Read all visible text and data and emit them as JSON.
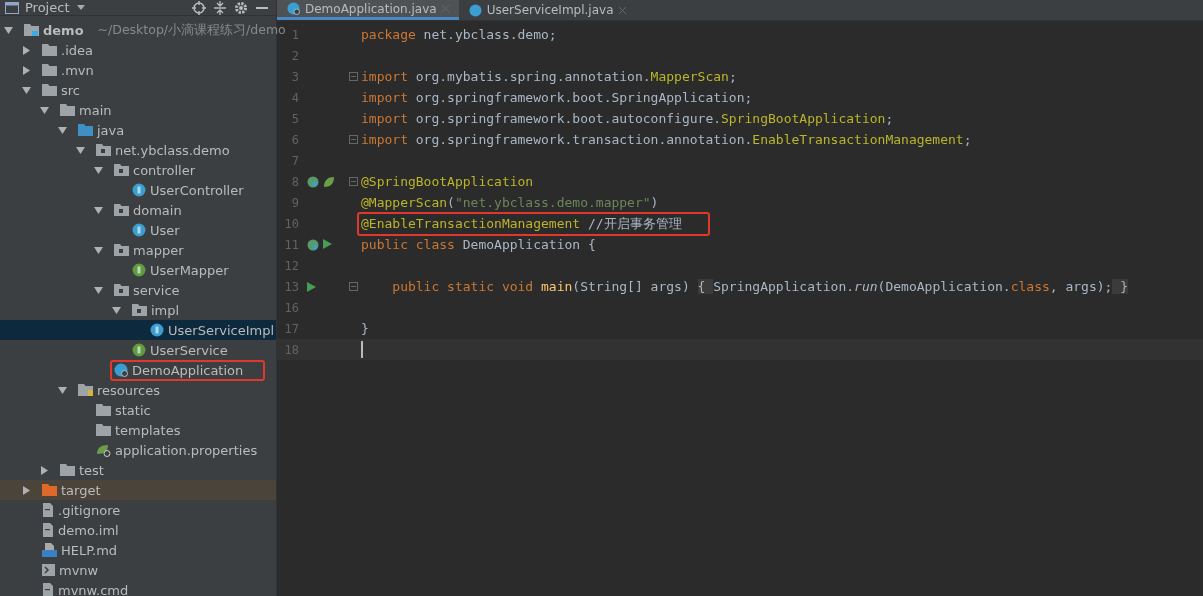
{
  "project_panel": {
    "title": "Project"
  },
  "tree": [
    {
      "label": "demo",
      "path": "~/Desktop/小滴课程练习/demo",
      "kind": "module",
      "expanded": true,
      "selected": false,
      "children": [
        {
          "label": ".idea",
          "kind": "folder",
          "expanded": false,
          "selected": false
        },
        {
          "label": ".mvn",
          "kind": "folder",
          "expanded": false,
          "selected": false
        },
        {
          "label": "src",
          "kind": "folder",
          "expanded": true,
          "selected": false,
          "children": [
            {
              "label": "main",
              "kind": "folder",
              "expanded": true,
              "selected": false,
              "children": [
                {
                  "label": "java",
                  "kind": "source-folder",
                  "expanded": true,
                  "selected": false,
                  "children": [
                    {
                      "label": "net.ybclass.demo",
                      "kind": "package",
                      "expanded": true,
                      "selected": false,
                      "children": [
                        {
                          "label": "controller",
                          "kind": "package",
                          "expanded": true,
                          "selected": false,
                          "children": [
                            {
                              "label": "UserController",
                              "kind": "class",
                              "selected": false
                            }
                          ]
                        },
                        {
                          "label": "domain",
                          "kind": "package",
                          "expanded": true,
                          "selected": false,
                          "children": [
                            {
                              "label": "User",
                              "kind": "class",
                              "selected": false
                            }
                          ]
                        },
                        {
                          "label": "mapper",
                          "kind": "package",
                          "expanded": true,
                          "selected": false,
                          "children": [
                            {
                              "label": "UserMapper",
                              "kind": "interface",
                              "selected": false
                            }
                          ]
                        },
                        {
                          "label": "service",
                          "kind": "package",
                          "expanded": true,
                          "selected": false,
                          "children": [
                            {
                              "label": "impl",
                              "kind": "package",
                              "expanded": true,
                              "selected": false,
                              "children": [
                                {
                                  "label": "UserServiceImpl",
                                  "kind": "class",
                                  "selected": true
                                }
                              ]
                            },
                            {
                              "label": "UserService",
                              "kind": "interface",
                              "selected": false
                            }
                          ]
                        },
                        {
                          "label": "DemoApplication",
                          "kind": "spring-class",
                          "selected": false,
                          "highlighted": true
                        }
                      ]
                    }
                  ]
                },
                {
                  "label": "resources",
                  "kind": "resource-folder",
                  "expanded": true,
                  "selected": false,
                  "children": [
                    {
                      "label": "static",
                      "kind": "folder",
                      "selected": false
                    },
                    {
                      "label": "templates",
                      "kind": "folder",
                      "selected": false
                    },
                    {
                      "label": "application.properties",
                      "kind": "spring-file",
                      "selected": false
                    }
                  ]
                }
              ]
            },
            {
              "label": "test",
              "kind": "folder",
              "expanded": false,
              "selected": false
            }
          ]
        },
        {
          "label": "target",
          "kind": "excluded-folder",
          "expanded": false,
          "selected": false
        },
        {
          "label": ".gitignore",
          "kind": "file",
          "selected": false
        },
        {
          "label": "demo.iml",
          "kind": "file",
          "selected": false
        },
        {
          "label": "HELP.md",
          "kind": "markdown",
          "selected": false
        },
        {
          "label": "mvnw",
          "kind": "script",
          "selected": false
        },
        {
          "label": "mvnw.cmd",
          "kind": "file",
          "selected": false
        }
      ]
    }
  ],
  "tabs": [
    {
      "label": "DemoApplication.java",
      "kind": "spring-class",
      "selected": true
    },
    {
      "label": "UserServiceImpl.java",
      "kind": "class",
      "selected": false
    }
  ],
  "lines": [
    {
      "number": "1",
      "tokens": [
        {
          "kind": "keyword",
          "text": "package"
        },
        {
          "kind": "plain",
          "text": " net.ybclass.demo;"
        }
      ]
    },
    {
      "number": "2"
    },
    {
      "number": "3",
      "fold": true,
      "tokens": [
        {
          "kind": "keyword",
          "text": "import"
        },
        {
          "kind": "plain",
          "text": " org.mybatis.spring.annotation."
        },
        {
          "kind": "annotation",
          "text": "MapperScan"
        },
        {
          "kind": "plain",
          "text": ";"
        }
      ]
    },
    {
      "number": "4",
      "tokens": [
        {
          "kind": "keyword",
          "text": "import"
        },
        {
          "kind": "plain",
          "text": " org.springframework.boot.SpringApplication;"
        }
      ]
    },
    {
      "number": "5",
      "tokens": [
        {
          "kind": "keyword",
          "text": "import"
        },
        {
          "kind": "plain",
          "text": " org.springframework.boot.autoconfigure."
        },
        {
          "kind": "annotation",
          "text": "SpringBootApplication"
        },
        {
          "kind": "plain",
          "text": ";"
        }
      ]
    },
    {
      "number": "6",
      "fold": true,
      "tokens": [
        {
          "kind": "keyword",
          "text": "import"
        },
        {
          "kind": "plain",
          "text": " org.springframework.transaction.annotation."
        },
        {
          "kind": "annotation",
          "text": "EnableTransactionManagement"
        },
        {
          "kind": "plain",
          "text": ";"
        }
      ]
    },
    {
      "number": "7"
    },
    {
      "number": "8",
      "fold": true,
      "gutter": [
        {
          "kind": "bean"
        },
        {
          "kind": "spring"
        }
      ],
      "tokens": [
        {
          "kind": "annotation",
          "text": "@SpringBootApplication"
        }
      ]
    },
    {
      "number": "9",
      "tokens": [
        {
          "kind": "annotation",
          "text": "@MapperScan"
        },
        {
          "kind": "plain",
          "text": "("
        },
        {
          "kind": "string",
          "text": "\"net.ybclass.demo.mapper\""
        },
        {
          "kind": "plain",
          "text": ")"
        }
      ]
    },
    {
      "number": "10",
      "highlighted": true,
      "tokens": [
        {
          "kind": "annotation",
          "text": "@EnableTransactionManagement"
        },
        {
          "kind": "comment",
          "text": " //开启事务管理"
        }
      ]
    },
    {
      "number": "11",
      "gutter": [
        {
          "kind": "bean"
        },
        {
          "kind": "run"
        }
      ],
      "tokens": [
        {
          "kind": "keyword",
          "text": "public class"
        },
        {
          "kind": "plain",
          "text": " DemoApplication {"
        }
      ]
    },
    {
      "number": "12"
    },
    {
      "number": "13",
      "fold": true,
      "gutter": [
        {
          "kind": "run"
        }
      ],
      "tokens": [
        {
          "kind": "keyword",
          "text": "    public static void"
        },
        {
          "kind": "method",
          "text": " main"
        },
        {
          "kind": "plain",
          "text": "(String[] args) "
        },
        {
          "kind": "folded",
          "text": "{ "
        },
        {
          "kind": "plain",
          "text": "SpringApplication."
        },
        {
          "kind": "italic",
          "text": "run"
        },
        {
          "kind": "plain",
          "text": "(DemoApplication."
        },
        {
          "kind": "keyword",
          "text": "class"
        },
        {
          "kind": "plain",
          "text": ", args);"
        },
        {
          "kind": "folded",
          "text": " }"
        }
      ]
    },
    {
      "number": "16"
    },
    {
      "number": "17",
      "tokens": [
        {
          "kind": "plain",
          "text": "}"
        }
      ]
    },
    {
      "number": "18",
      "current": true
    }
  ]
}
